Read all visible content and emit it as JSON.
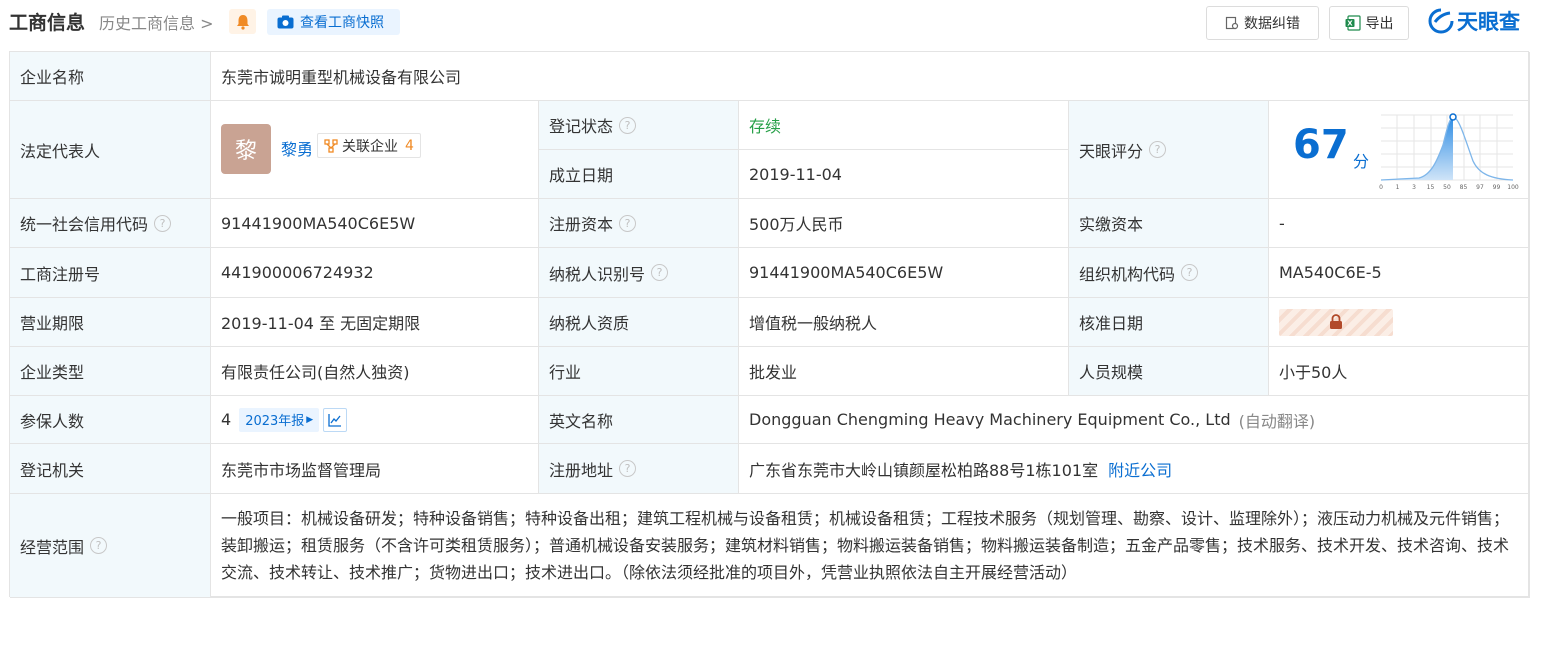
{
  "header": {
    "title": "工商信息",
    "history": "历史工商信息",
    "snapshot": "查看工商快照",
    "feedback": "数据纠错",
    "export": "导出",
    "logo": "天眼查"
  },
  "company": {
    "name_label": "企业名称",
    "name": "东莞市诚明重型机械设备有限公司",
    "legal_label": "法定代表人",
    "avatar_char": "黎",
    "legal_name": "黎勇",
    "related_label": "关联企业",
    "related_count": "4",
    "status_label": "登记状态",
    "status": "存续",
    "found_label": "成立日期",
    "found_date": "2019-11-04",
    "score_label": "天眼评分",
    "score": "67",
    "score_unit": "分",
    "score_axis": [
      "0",
      "1",
      "3",
      "15",
      "50",
      "85",
      "97",
      "99",
      "100"
    ],
    "credit_label": "统一社会信用代码",
    "credit_code": "91441900MA540C6E5W",
    "capital_label": "注册资本",
    "capital": "500万人民币",
    "paid_label": "实缴资本",
    "paid": "-",
    "reg_no_label": "工商注册号",
    "reg_no": "441900006724932",
    "tax_label": "纳税人识别号",
    "tax_no": "91441900MA540C6E5W",
    "org_label": "组织机构代码",
    "org_code": "MA540C6E-5",
    "term_label": "营业期限",
    "term": "2019-11-04 至 无固定期限",
    "tax_quality_label": "纳税人资质",
    "tax_quality": "增值税一般纳税人",
    "approve_label": "核准日期",
    "type_label": "企业类型",
    "type": "有限责任公司(自然人独资)",
    "industry_label": "行业",
    "industry": "批发业",
    "staff_label": "人员规模",
    "staff": "小于50人",
    "insured_label": "参保人数",
    "insured": "4",
    "report_year": "2023年报",
    "en_label": "英文名称",
    "en_name": "Dongguan Chengming Heavy Machinery Equipment Co., Ltd",
    "en_note": "(自动翻译)",
    "authority_label": "登记机关",
    "authority": "东莞市市场监督管理局",
    "address_label": "注册地址",
    "address": "广东省东莞市大岭山镇颜屋松柏路88号1栋101室",
    "nearby": "附近公司",
    "scope_label": "经营范围",
    "scope": "一般项目：机械设备研发；特种设备销售；特种设备出租；建筑工程机械与设备租赁；机械设备租赁；工程技术服务（规划管理、勘察、设计、监理除外）；液压动力机械及元件销售；装卸搬运；租赁服务（不含许可类租赁服务）；普通机械设备安装服务；建筑材料销售；物料搬运装备销售；物料搬运装备制造；五金产品零售；技术服务、技术开发、技术咨询、技术交流、技术转让、技术推广；货物进出口；技术进出口。（除依法须经批准的项目外，凭营业执照依法自主开展经营活动）"
  },
  "colors": {
    "accent": "#0a6ed1",
    "label_bg": "#f2f9fc",
    "status": "#27a048",
    "orange": "#f08a24"
  }
}
